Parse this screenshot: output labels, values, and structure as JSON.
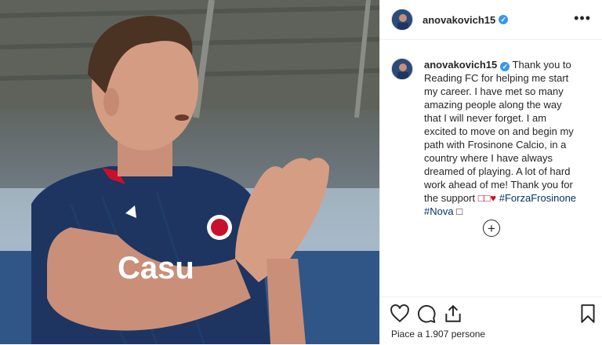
{
  "post": {
    "username": "anovakovich15",
    "caption_lines": [
      "Thank you to",
      "Reading FC for helping me start my",
      "career. I have met so many amazing",
      "people along the way that I will never",
      "forget. I am excited to move on and",
      "begin my path with Frosinone Calcio,",
      "in a country where I have always",
      "dreamed of playing. A lot of hard work",
      "ahead of me! Thank you for the",
      "support"
    ],
    "caption_emojis": "□□♥",
    "hashtags": [
      "#ForzaFrosinone",
      "#Nova"
    ],
    "caption_trailing_emoji": "□",
    "likes_text": "Piace a 1.907 persone",
    "more_label": "•••",
    "load_more_label": "+"
  },
  "photo": {
    "shirt_text": "Casu",
    "colors": {
      "kit_navy": "#1d3560",
      "accent_red": "#c8102e",
      "verified_blue": "#3897f0",
      "hashtag_blue": "#003569"
    }
  },
  "icons": [
    "heart-icon",
    "comment-icon",
    "share-icon",
    "bookmark-icon",
    "plus-circle-icon",
    "more-options-icon",
    "verified-badge-icon"
  ]
}
